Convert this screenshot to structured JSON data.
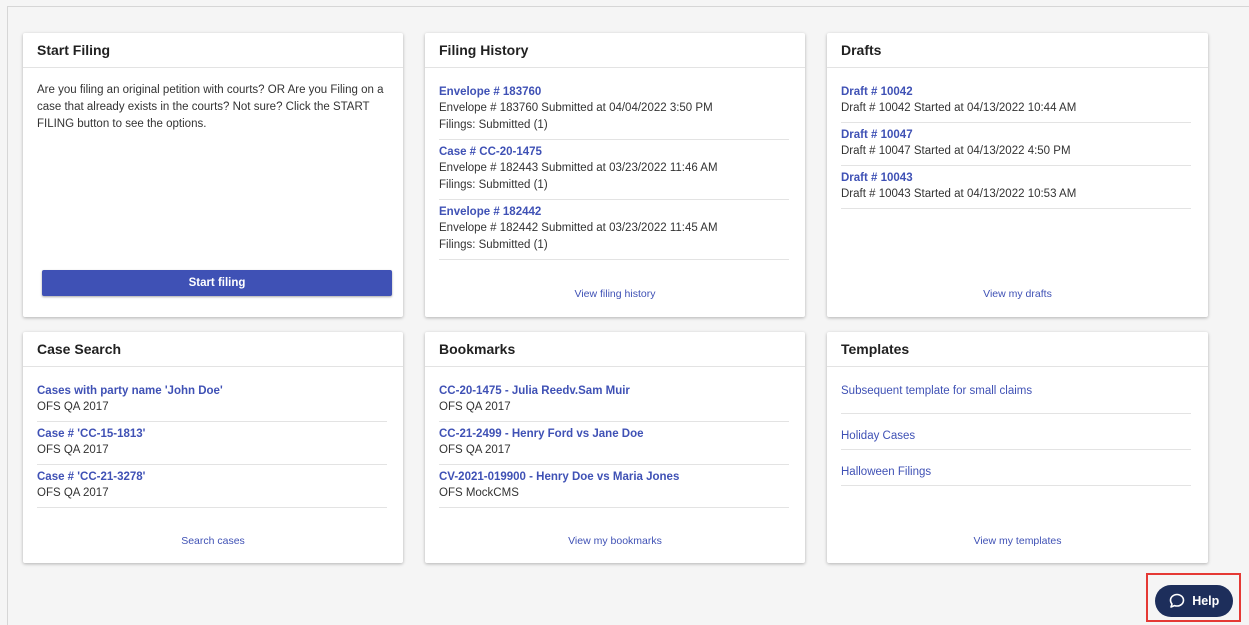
{
  "start_filing": {
    "title": "Start Filing",
    "description": "Are you filing an original petition with courts? OR Are you Filing on a case that already exists in the courts? Not sure? Click the START FILING button to see the options.",
    "button_label": "Start filing"
  },
  "filing_history": {
    "title": "Filing History",
    "items": [
      {
        "link": "Envelope # 183760",
        "line1": "Envelope # 183760 Submitted at 04/04/2022 3:50 PM",
        "line2": "Filings: Submitted (1)"
      },
      {
        "link": "Case # CC-20-1475",
        "line1": "Envelope # 182443 Submitted at 03/23/2022 11:46 AM",
        "line2": "Filings: Submitted (1)"
      },
      {
        "link": "Envelope # 182442",
        "line1": "Envelope # 182442 Submitted at 03/23/2022 11:45 AM",
        "line2": "Filings: Submitted (1)"
      }
    ],
    "footer": "View filing history"
  },
  "drafts": {
    "title": "Drafts",
    "items": [
      {
        "link": "Draft # 10042",
        "line1": "Draft # 10042 Started at 04/13/2022 10:44 AM"
      },
      {
        "link": "Draft # 10047",
        "line1": "Draft # 10047 Started at 04/13/2022 4:50 PM"
      },
      {
        "link": "Draft # 10043",
        "line1": "Draft # 10043 Started at 04/13/2022 10:53 AM"
      }
    ],
    "footer": "View my drafts"
  },
  "case_search": {
    "title": "Case Search",
    "items": [
      {
        "link": "Cases with party name 'John Doe'",
        "line1": "OFS QA 2017"
      },
      {
        "link": "Case # 'CC-15-1813'",
        "line1": "OFS QA 2017"
      },
      {
        "link": "Case # 'CC-21-3278'",
        "line1": "OFS QA 2017"
      }
    ],
    "footer": "Search cases"
  },
  "bookmarks": {
    "title": "Bookmarks",
    "items": [
      {
        "link": "CC-20-1475 - Julia Reedv.Sam Muir",
        "line1": "OFS QA 2017"
      },
      {
        "link": "CC-21-2499 - Henry Ford vs Jane Doe",
        "line1": "OFS QA 2017"
      },
      {
        "link": "CV-2021-019900 - Henry Doe vs Maria Jones",
        "line1": "OFS MockCMS"
      }
    ],
    "footer": "View my bookmarks"
  },
  "templates": {
    "title": "Templates",
    "items": [
      "Subsequent template for small claims",
      "Holiday Cases",
      "Halloween Filings"
    ],
    "footer": "View my templates"
  },
  "help": {
    "label": "Help",
    "icon": "chat-bubble-icon",
    "button_color": "#1d2e5b",
    "highlight_color": "#e53935"
  },
  "accent_color": "#3f51b5"
}
